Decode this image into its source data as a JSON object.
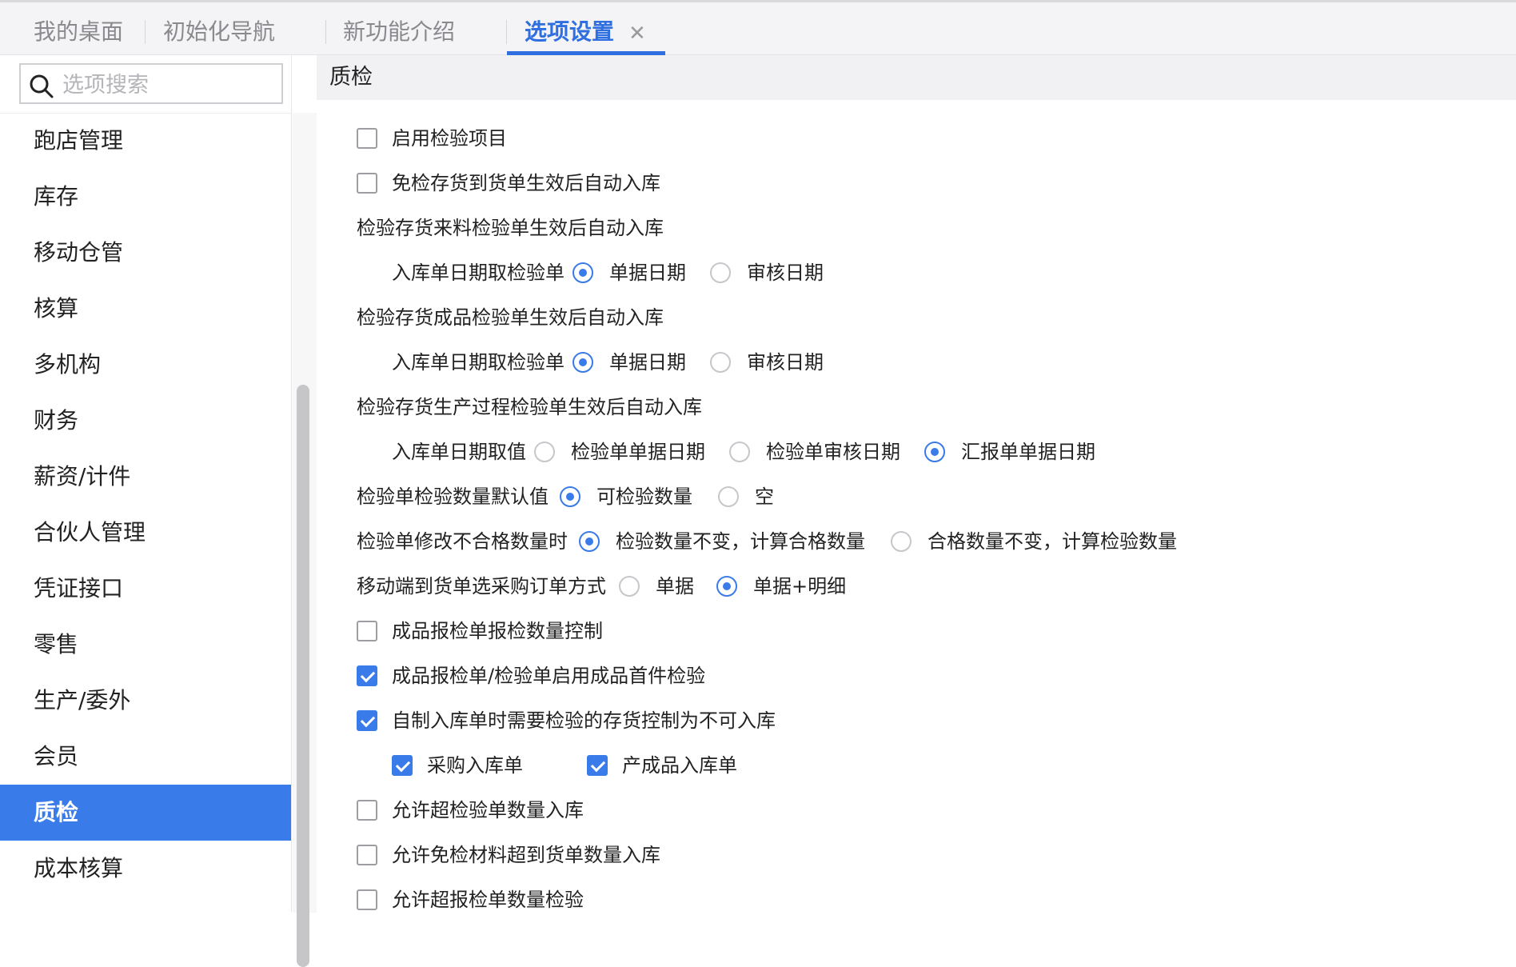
{
  "tabs": [
    {
      "label": "我的桌面"
    },
    {
      "label": "初始化导航"
    },
    {
      "label": "新功能介绍"
    },
    {
      "label": "选项设置",
      "active": true
    }
  ],
  "search": {
    "placeholder": "选项搜索"
  },
  "sidebar": {
    "items": [
      {
        "label": "跑店管理"
      },
      {
        "label": "库存"
      },
      {
        "label": "移动仓管"
      },
      {
        "label": "核算"
      },
      {
        "label": "多机构"
      },
      {
        "label": "财务"
      },
      {
        "label": "薪资/计件"
      },
      {
        "label": "合伙人管理"
      },
      {
        "label": "凭证接口"
      },
      {
        "label": "零售"
      },
      {
        "label": "生产/委外"
      },
      {
        "label": "会员"
      },
      {
        "label": "质检",
        "active": true
      },
      {
        "label": "成本核算"
      }
    ]
  },
  "main": {
    "section_title": "质检",
    "enable_inspection_items": {
      "label": "启用检验项目",
      "checked": false
    },
    "exempt_auto_inbound": {
      "label": "免检存货到货单生效后自动入库",
      "checked": false
    },
    "incoming_group": {
      "title": "检验存货来料检验单生效后自动入库",
      "label": "入库单日期取检验单",
      "options": [
        "单据日期",
        "审核日期"
      ],
      "selected": "单据日期"
    },
    "finished_group": {
      "title": "检验存货成品检验单生效后自动入库",
      "label": "入库单日期取检验单",
      "options": [
        "单据日期",
        "审核日期"
      ],
      "selected": "单据日期"
    },
    "process_group": {
      "title": "检验存货生产过程检验单生效后自动入库",
      "label": "入库单日期取值",
      "options": [
        "检验单单据日期",
        "检验单审核日期",
        "汇报单单据日期"
      ],
      "selected": "汇报单单据日期"
    },
    "default_qty": {
      "label": "检验单检验数量默认值",
      "options": [
        "可检验数量",
        "空"
      ],
      "selected": "可检验数量"
    },
    "modify_unqualified": {
      "label": "检验单修改不合格数量时",
      "options": [
        "检验数量不变，计算合格数量",
        "合格数量不变，计算检验数量"
      ],
      "selected": "检验数量不变，计算合格数量"
    },
    "mobile_po_mode": {
      "label": "移动端到货单选采购订单方式",
      "options": [
        "单据",
        "单据+明细"
      ],
      "selected": "单据+明细"
    },
    "finished_report_qty_control": {
      "label": "成品报检单报检数量控制",
      "checked": false
    },
    "first_piece_inspection": {
      "label": "成品报检单/检验单启用成品首件检验",
      "checked": true
    },
    "self_made_inbound_control": {
      "label": "自制入库单时需要检验的存货控制为不可入库",
      "checked": true
    },
    "purchase_inbound": {
      "label": "采购入库单",
      "checked": true
    },
    "product_inbound": {
      "label": "产成品入库单",
      "checked": true
    },
    "allow_exceed_inspection": {
      "label": "允许超检验单数量入库",
      "checked": false
    },
    "allow_exempt_exceed": {
      "label": "允许免检材料超到货单数量入库",
      "checked": false
    },
    "allow_exceed_report": {
      "label": "允许超报检单数量检验",
      "checked": false
    }
  },
  "colors": {
    "accent": "#3a7bea",
    "tab_active": "#2f6fe0"
  }
}
